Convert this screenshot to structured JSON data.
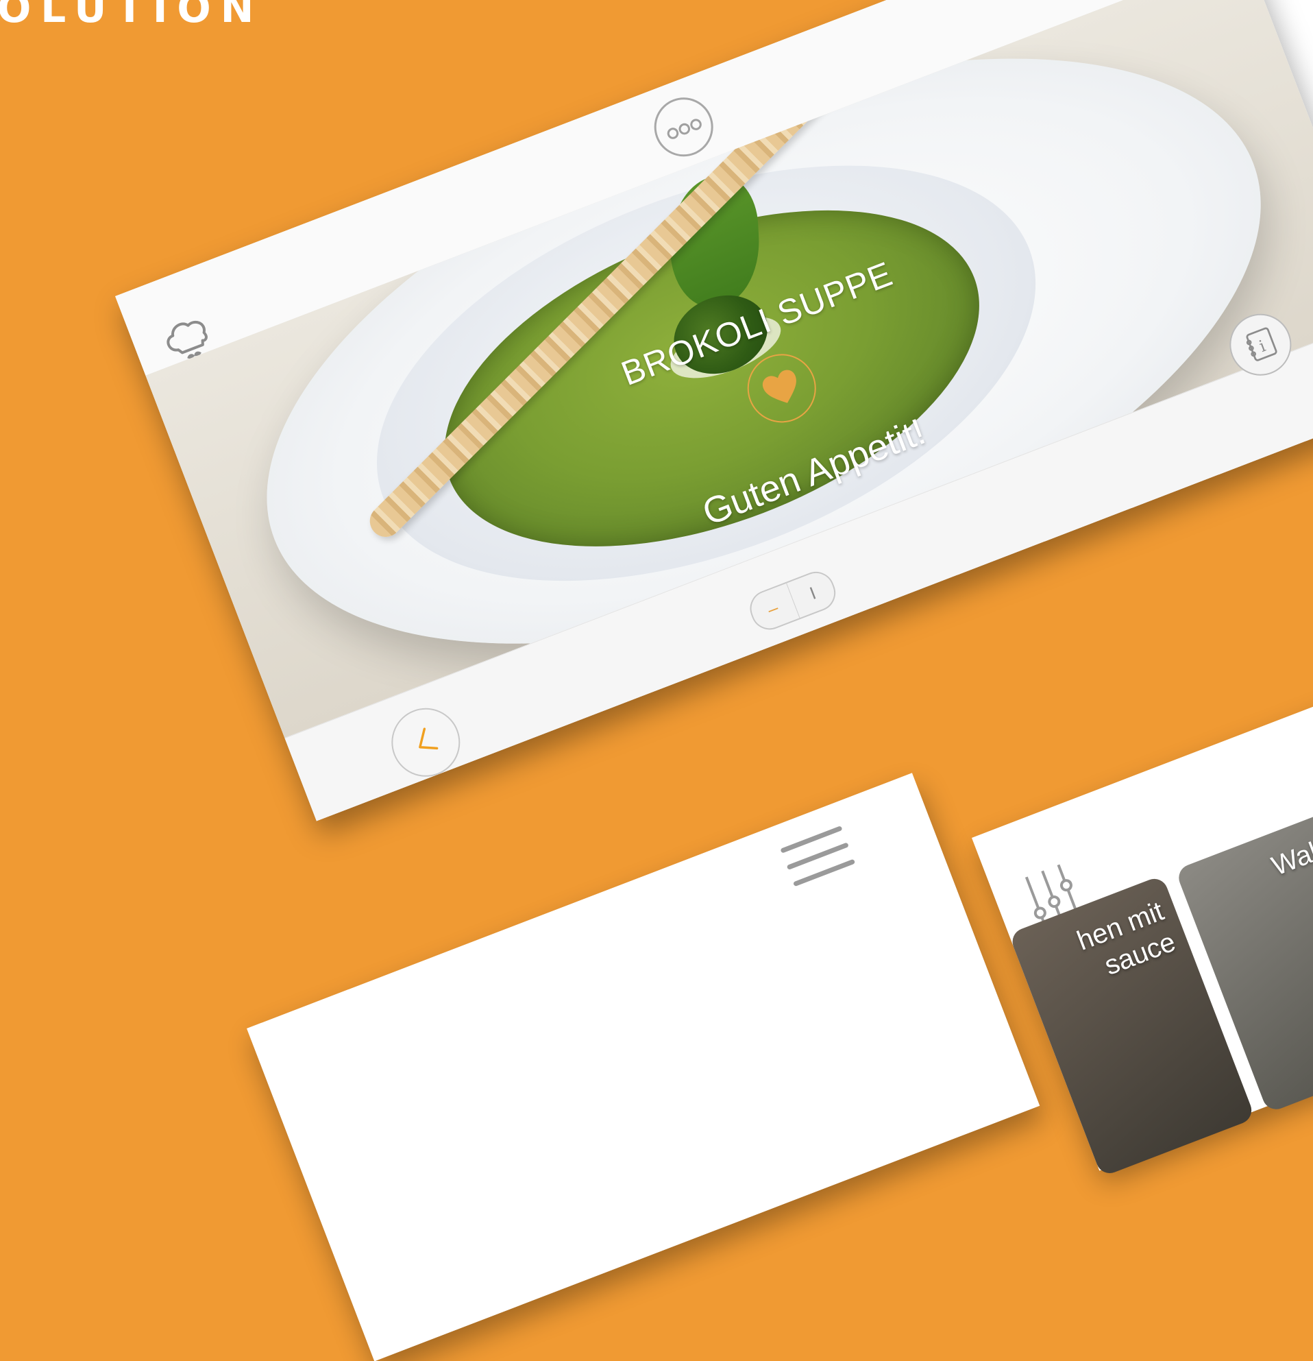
{
  "page": {
    "heading": "OLUTION",
    "background_color": "#f09a33",
    "accent_color": "#e8a444"
  },
  "main_screen": {
    "recipe_title": "BROKOLI SUPPE",
    "subtitle": "Guten Appetit!",
    "icons": {
      "chef": "chef-hat-icon",
      "dots": "more-dots-icon",
      "menu": "hamburger-menu-icon",
      "favorite": "heart-icon",
      "info": "info-book-icon",
      "back": "back-arrow-icon"
    },
    "toggle": {
      "option_1": "–",
      "option_2": "I"
    }
  },
  "lower_right_screen": {
    "cards": [
      {
        "label": "hen mit\nsauce"
      },
      {
        "label": "Walnuss S\nNud"
      }
    ]
  }
}
